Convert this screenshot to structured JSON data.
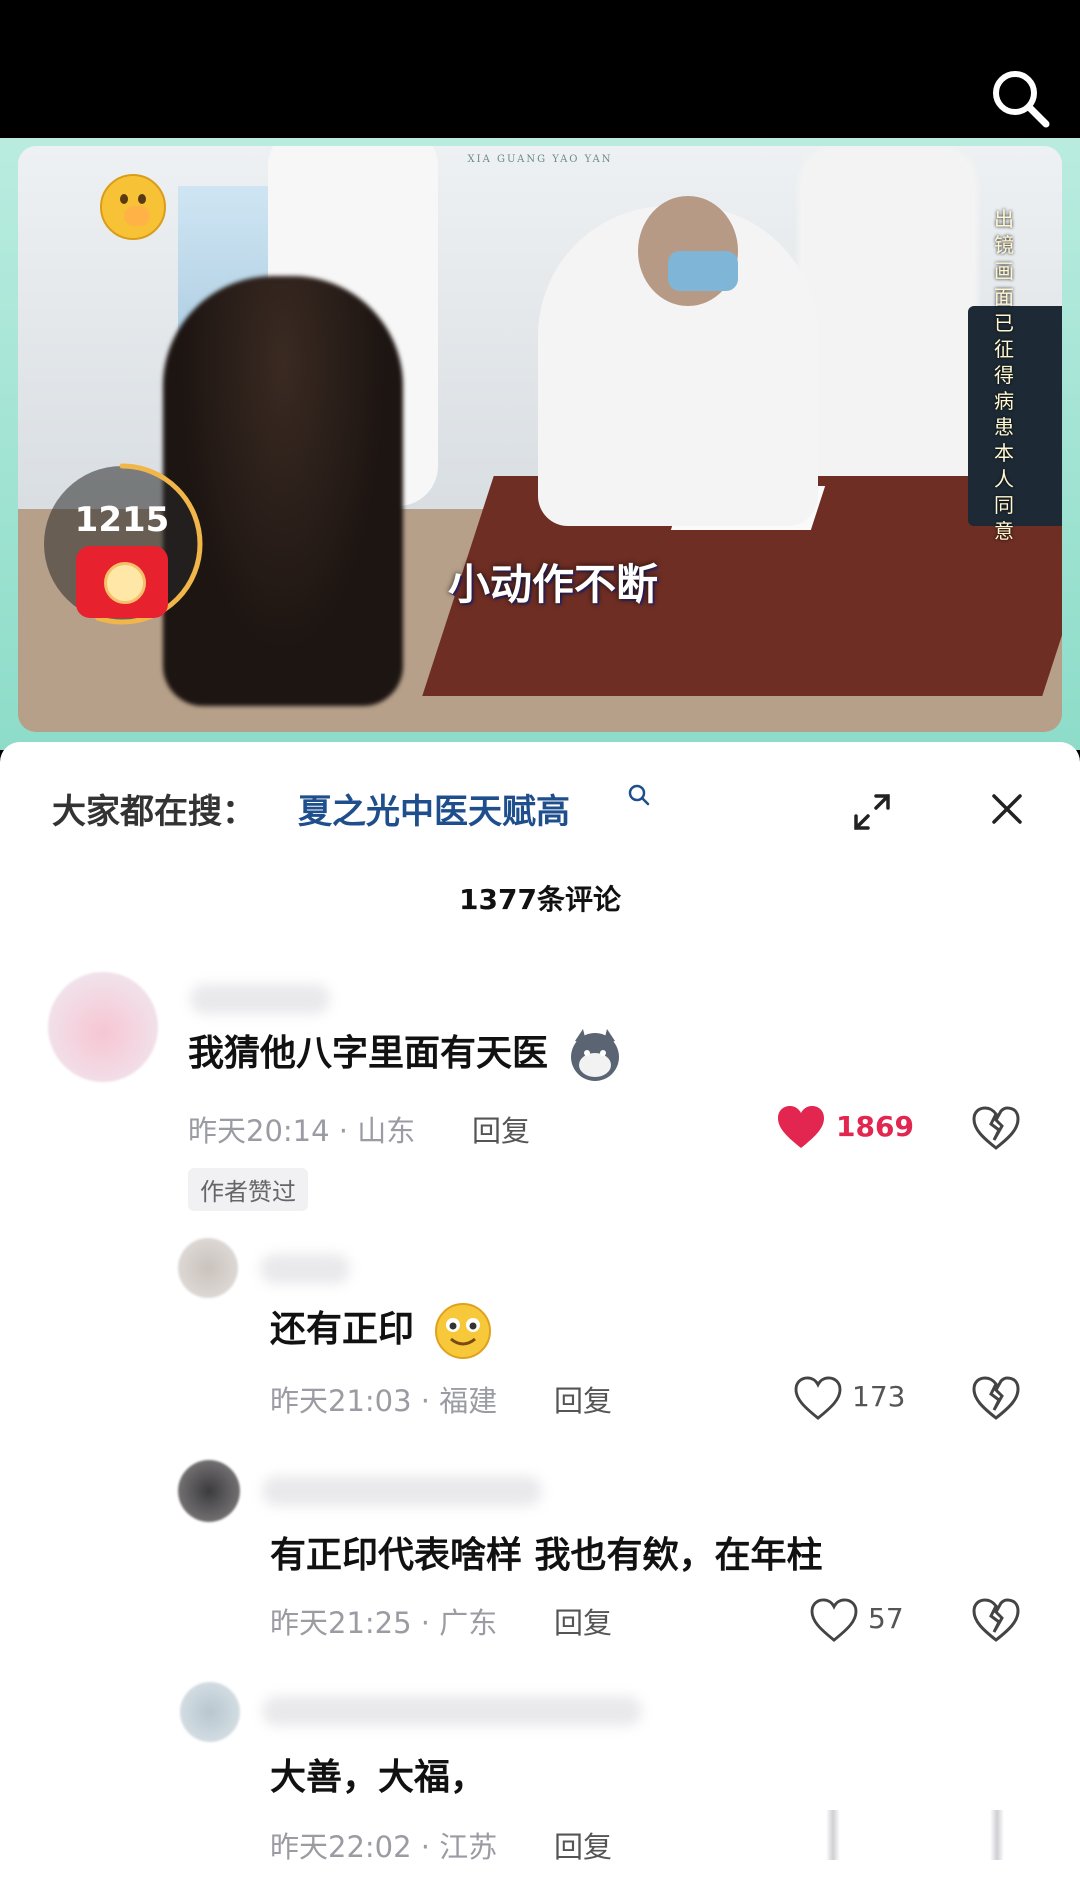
{
  "video": {
    "brand_text": "XIA GUANG YAO YAN",
    "caption": "小动作不断",
    "vertical_note": "出镜画面已征得病患本人同意",
    "redpacket_count": "1215",
    "redpacket_progress": 0.55
  },
  "panel": {
    "hot_search_label": "大家都在搜：",
    "hot_search_query": "夏之光中医天赋高",
    "comment_count": "1377条评论"
  },
  "comments": [
    {
      "text": "我猜他八字里面有天医",
      "time": "昨天20:14",
      "location": "山东",
      "reply_label": "回复",
      "likes": "1869",
      "liked": true,
      "author_badge": "作者赞过"
    },
    {
      "text": "还有正印",
      "time": "昨天21:03",
      "location": "福建",
      "reply_label": "回复",
      "likes": "173"
    },
    {
      "text": "有正印代表啥样 我也有欸，在年柱",
      "time": "昨天21:25",
      "location": "广东",
      "reply_label": "回复",
      "likes": "57"
    },
    {
      "text": "大善，大福，",
      "time": "昨天22:02",
      "location": "江苏",
      "reply_label": "回复"
    }
  ],
  "colors": {
    "link": "#1f4e8c",
    "like_active": "#e3264f",
    "redpacket": "#e8212f",
    "frame_green": "#8ddcc9"
  },
  "icons": [
    "search-icon",
    "hush-emoji",
    "red-packet-icon",
    "expand-icon",
    "close-icon",
    "heart-icon",
    "broken-heart-icon",
    "husky-emoji",
    "smile-emoji"
  ]
}
